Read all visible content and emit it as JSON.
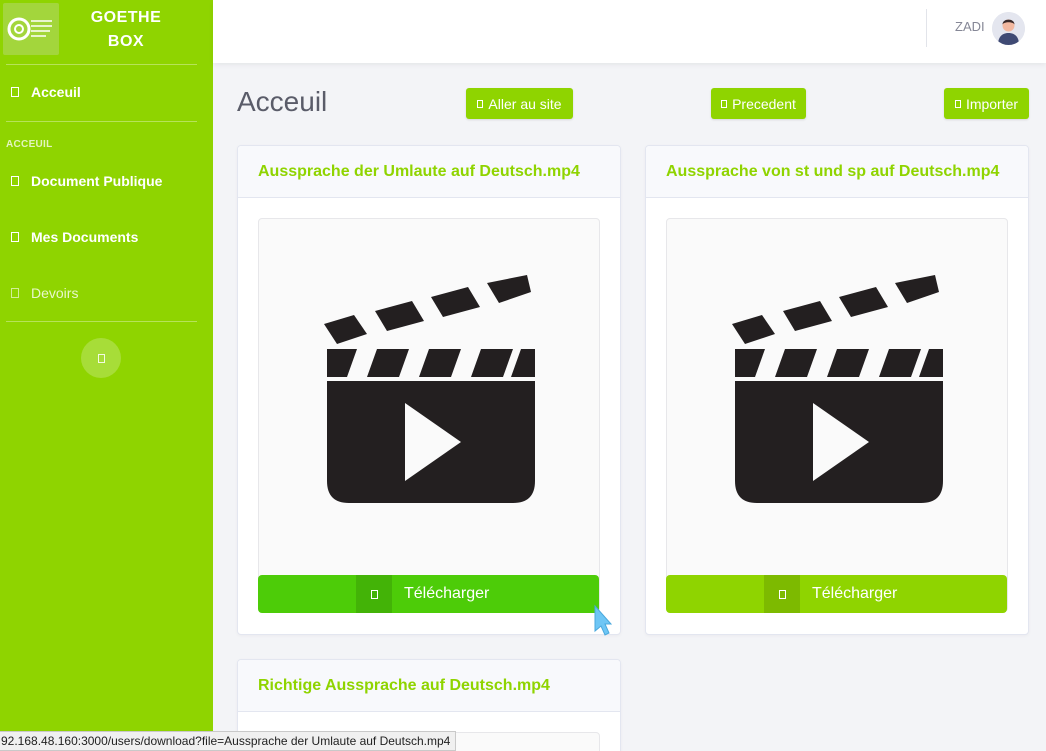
{
  "sidebar": {
    "brand_line1": "GOETHE",
    "brand_line2": "BOX",
    "items": [
      {
        "label": "Acceuil"
      },
      {
        "label": "Document Publique"
      },
      {
        "label": "Mes Documents"
      },
      {
        "label": "Devoirs"
      }
    ],
    "section_heading": "ACCEUIL"
  },
  "topbar": {
    "user_name": "ZADI"
  },
  "main": {
    "title": "Acceuil",
    "buttons": {
      "go_site": "Aller au site",
      "previous": "Precedent",
      "import": "Importer"
    },
    "cards": [
      {
        "title": "Aussprache der Umlaute auf Deutsch.mp4",
        "download_label": "Télécharger"
      },
      {
        "title": "Aussprache von st und sp auf Deutsch.mp4",
        "download_label": "Télécharger"
      },
      {
        "title": "Richtige Aussprache auf Deutsch.mp4"
      }
    ]
  },
  "statusbar": {
    "url": "92.168.48.160:3000/users/download?file=Aussprache der Umlaute auf Deutsch.mp4"
  },
  "icons": {
    "thumbnail": "clapperboard-play-icon"
  },
  "colors": {
    "accent": "#8fd400",
    "accent_hover": "#4dcc08"
  }
}
